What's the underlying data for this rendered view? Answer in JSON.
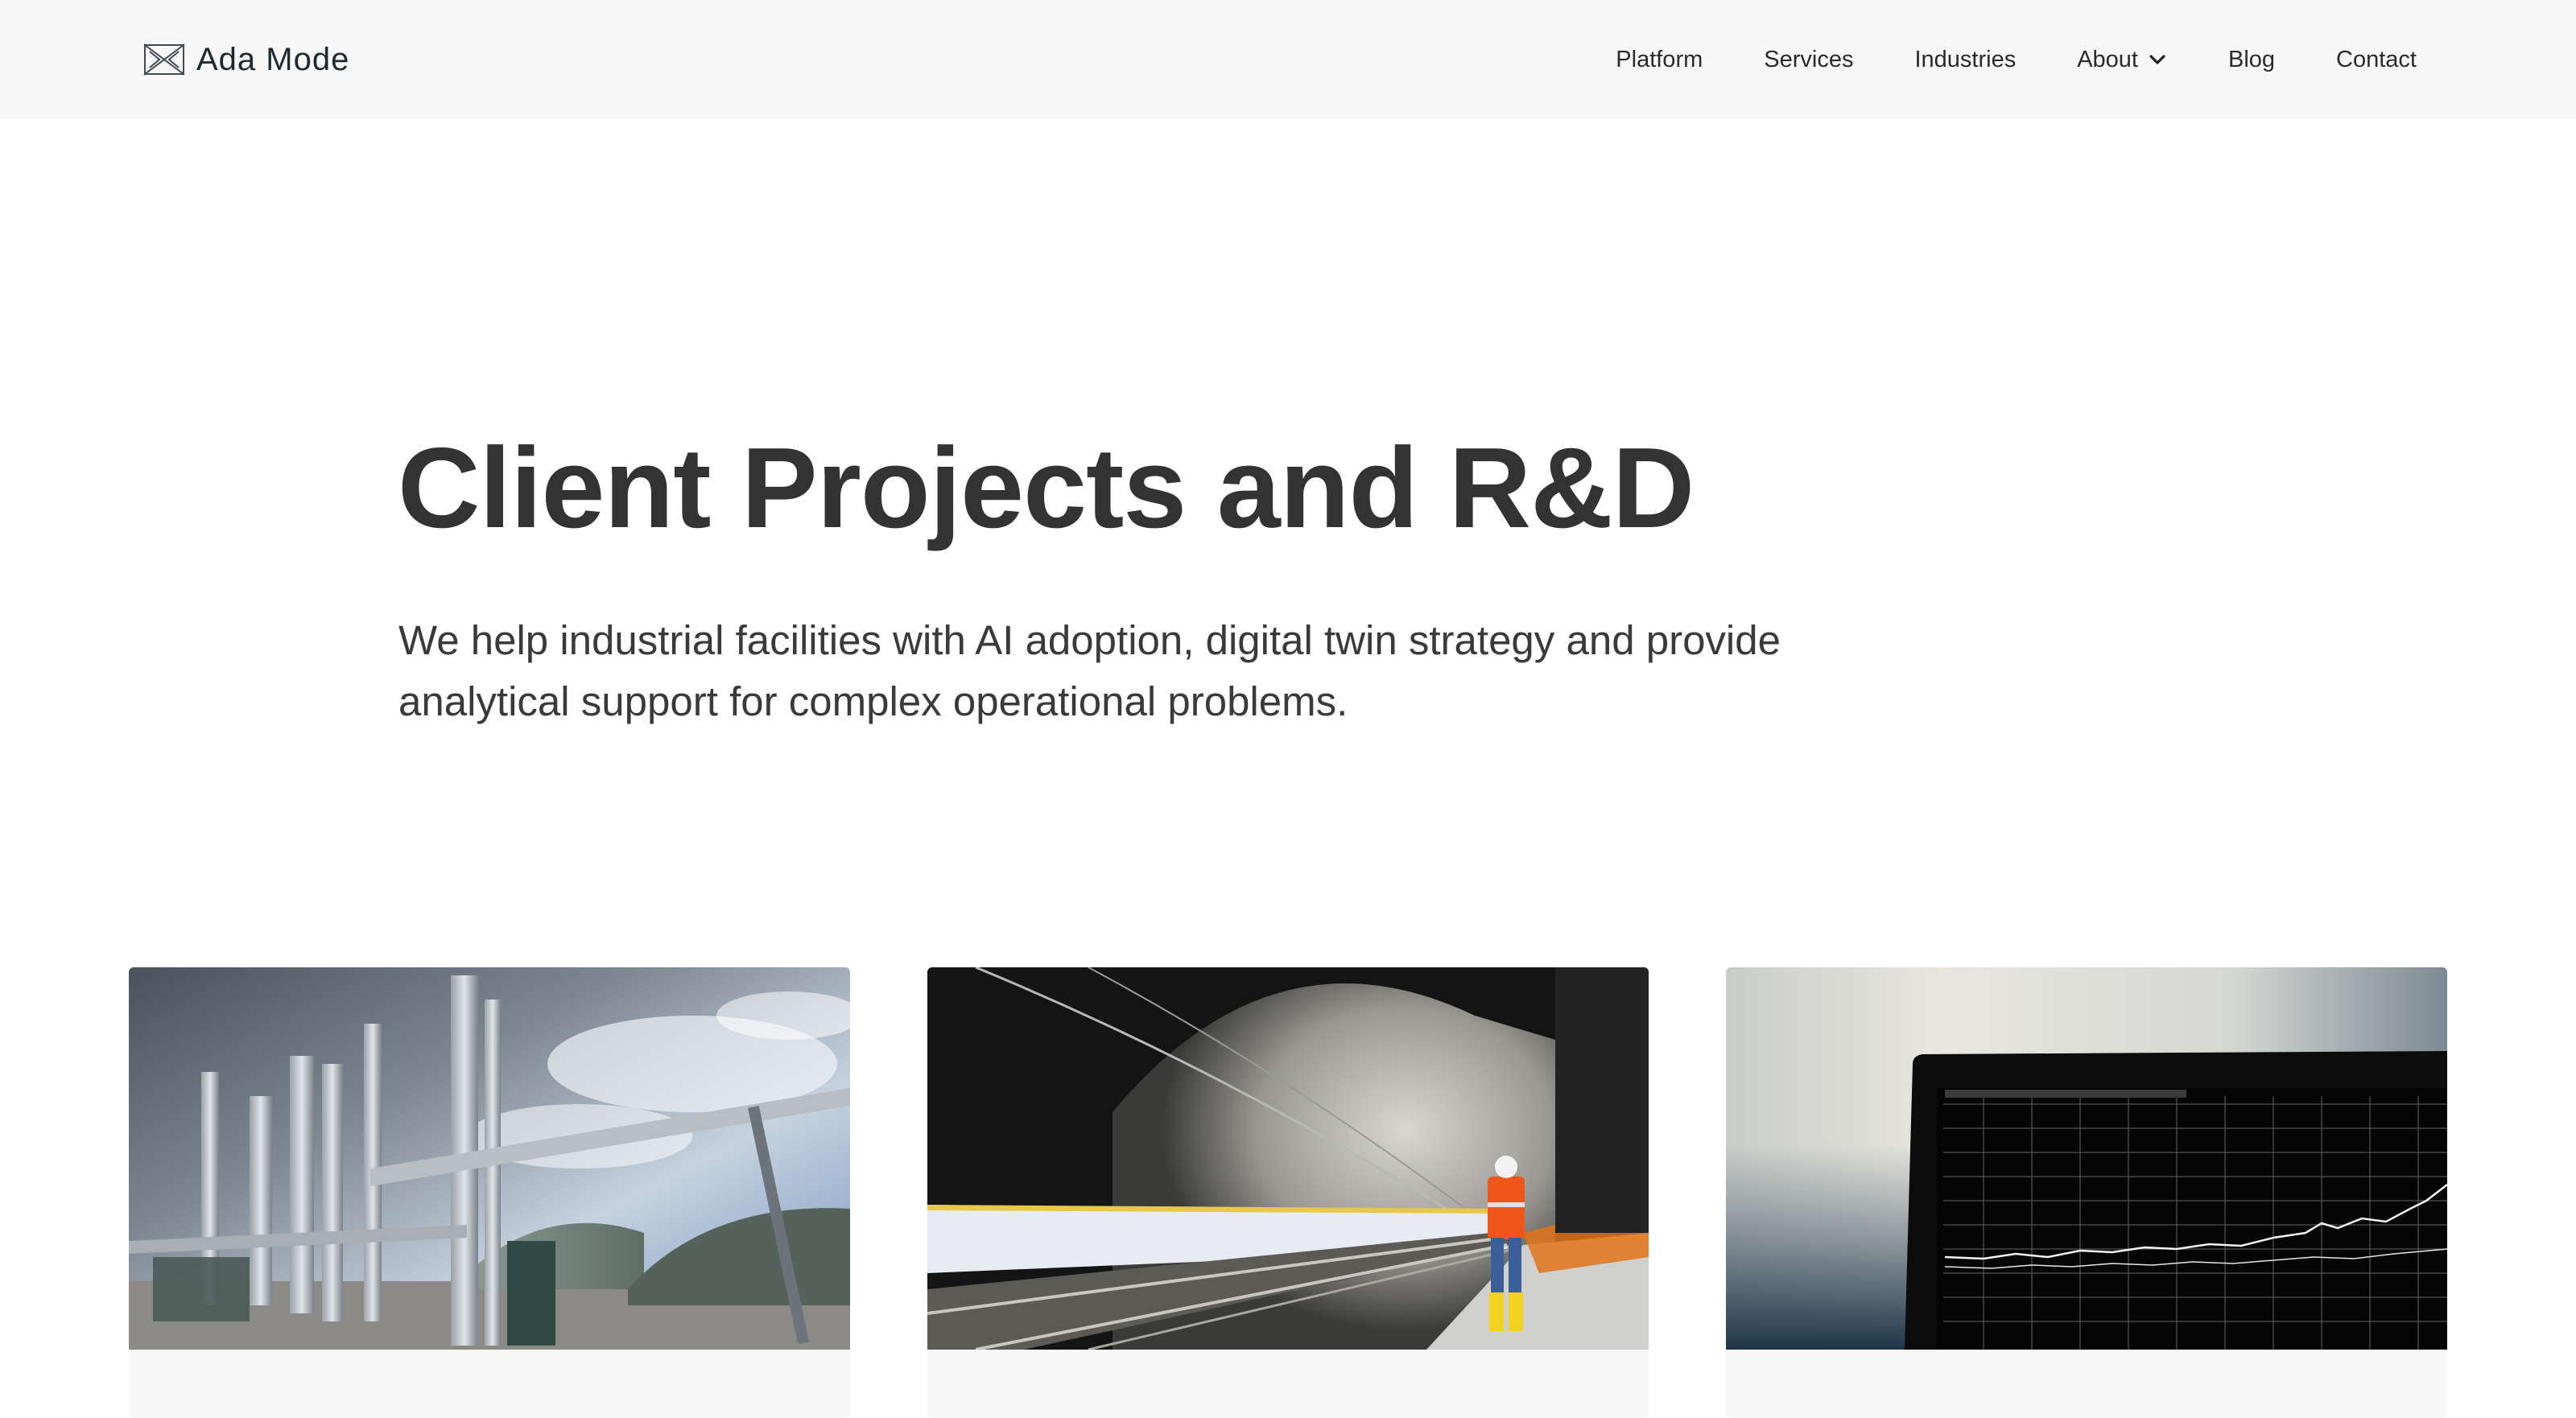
{
  "brand": {
    "name": "Ada Mode",
    "logo_icon": "bowtie-logo-icon"
  },
  "nav": {
    "items": [
      {
        "label": "Platform"
      },
      {
        "label": "Services"
      },
      {
        "label": "Industries"
      },
      {
        "label": "About",
        "has_dropdown": true
      },
      {
        "label": "Blog"
      },
      {
        "label": "Contact"
      }
    ],
    "dropdown_icon": "chevron-down-icon"
  },
  "hero": {
    "title": "Client Projects and R&D",
    "subtitle": "We help industrial facilities with AI adoption, digital twin strategy and provide analytical support for complex operational problems."
  },
  "cards": [
    {
      "image": "industrial-plant-pipes-photo"
    },
    {
      "image": "tunnel-railway-worker-photo"
    },
    {
      "image": "laptop-stock-chart-photo"
    }
  ],
  "colors": {
    "header_bg": "#f7f7f7",
    "text_dark": "#333333",
    "card_footer_bg": "#f6f6f6"
  }
}
